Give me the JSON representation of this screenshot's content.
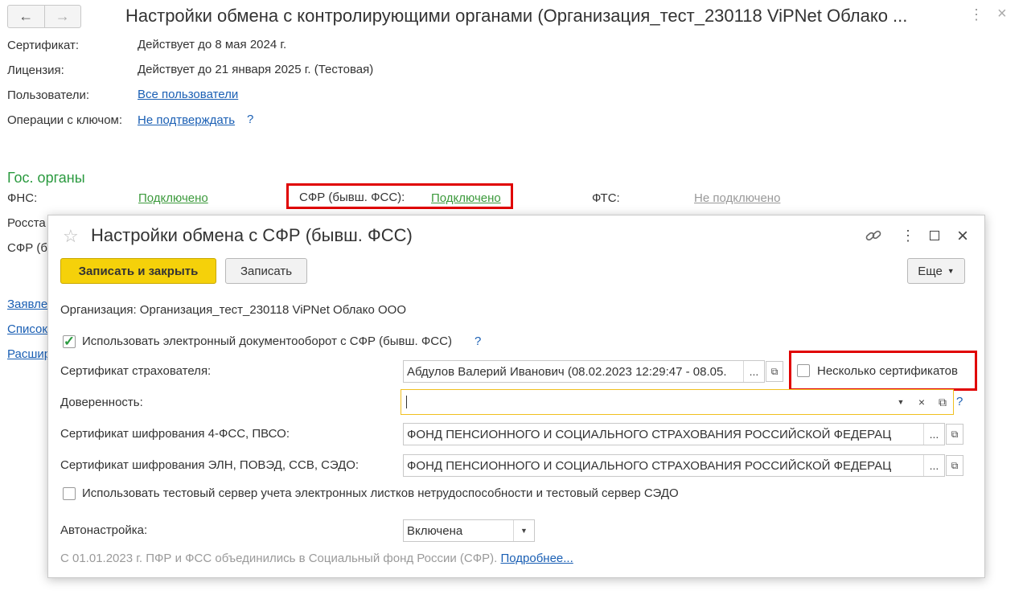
{
  "header": {
    "back_icon": "arrow-left-icon",
    "forward_icon": "arrow-right-icon",
    "title": "Настройки обмена с контролирующими органами (Организация_тест_230118 ViPNet Облако ...",
    "more_icon": "kebab-icon",
    "close_icon": "close-icon"
  },
  "info": {
    "certificate_label": "Сертификат:",
    "certificate_value": "Действует до 8 мая 2024 г.",
    "license_label": "Лицензия:",
    "license_value": "Действует до 21 января 2025 г. (Тестовая)",
    "users_label": "Пользователи:",
    "users_link": "Все пользователи",
    "key_ops_label": "Операции с ключом:",
    "key_ops_link": "Не подтверждать",
    "help": "?"
  },
  "gov": {
    "section_title": "Гос. органы",
    "fns_label": "ФНС:",
    "fns_status": "Подключено",
    "sfr_label": "СФР (бывш. ФСС):",
    "sfr_status": "Подключено",
    "fts_label": "ФТС:",
    "fts_status": "Не подключено",
    "rosstat_label": "Росста",
    "sfr2_label": "СФР (б"
  },
  "side_links": [
    "Заявле",
    "Список",
    "Расшир"
  ],
  "dialog": {
    "title": "Настройки обмена с СФР (бывш. ФСС)",
    "star_icon": "star-icon",
    "link_icon": "link-icon",
    "more_icon": "kebab-icon",
    "maximize_icon": "maximize-icon",
    "close_icon": "close-icon",
    "save_close_label": "Записать и закрыть",
    "save_label": "Записать",
    "more_label": "Еще",
    "organization": "Организация: Организация_тест_230118 ViPNet Облако ООО",
    "use_edo_label": "Использовать электронный документооборот с СФР (бывш. ФСС)",
    "use_edo_checked": true,
    "help": "?",
    "insurer_cert_label": "Сертификат страхователя:",
    "insurer_cert_value": "Абдулов Валерий Иванович (08.02.2023 12:29:47 - 08.05.",
    "multi_cert_label": "Несколько сертификатов",
    "multi_cert_checked": false,
    "proxy_label": "Доверенность:",
    "proxy_value": "",
    "enc_cert_4fss_label": "Сертификат шифрования 4-ФСС, ПВСО:",
    "enc_cert_4fss_value": "ФОНД ПЕНСИОННОГО И СОЦИАЛЬНОГО СТРАХОВАНИЯ РОССИЙСКОЙ ФЕДЕРАЦ",
    "enc_cert_eln_label": "Сертификат шифрования ЭЛН, ПОВЭД, ССВ, СЭДО:",
    "enc_cert_eln_value": "ФОНД ПЕНСИОННОГО И СОЦИАЛЬНОГО СТРАХОВАНИЯ РОССИЙСКОЙ ФЕДЕРАЦ",
    "test_server_label": "Использовать тестовый сервер учета электронных листков нетрудоспособности и тестовый сервер СЭДО",
    "test_server_checked": false,
    "autoconfig_label": "Автонастройка:",
    "autoconfig_value": "Включена",
    "footer_note": "С 01.01.2023 г. ПФР и ФСС объединились в Социальный фонд России (СФР).",
    "footer_link": "Подробнее..."
  },
  "colors": {
    "accent_yellow": "#f5d10a",
    "link_blue": "#1a5fb4",
    "status_green": "#3c9a3c",
    "highlight_red": "#e00000"
  }
}
